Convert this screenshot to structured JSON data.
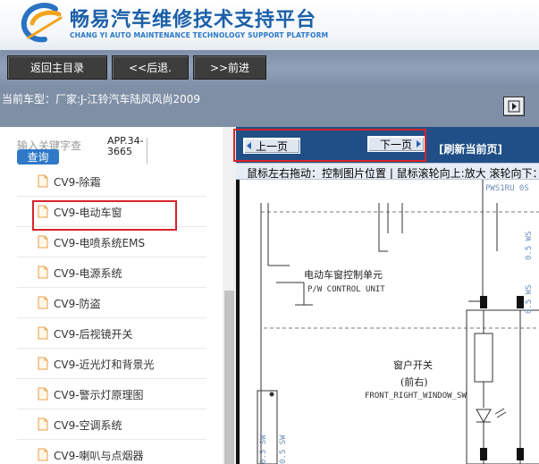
{
  "header": {
    "title": "畅易汽车维修技术支持平台",
    "subtitle": "CHANG YI AUTO MAINTENANCE TECHNOLOGY SUPPORT PLATFORM",
    "logo_icon": "swoosh-c-logo-icon"
  },
  "toolbar": {
    "home_label": "返回主目录",
    "back_label": "<<后退.",
    "forward_label": ">>前进"
  },
  "vehicle": {
    "label": "当前车型：",
    "value": "厂家:J-江铃汽车陆风风尚2009"
  },
  "search": {
    "hint": "输入关键字查",
    "button_label": "查询",
    "app_code": "APP.34-3665"
  },
  "tree": {
    "items": [
      {
        "label": "CV9-除霜",
        "selected": false
      },
      {
        "label": "CV9-电动车窗",
        "selected": true
      },
      {
        "label": "CV9-电喷系统EMS",
        "selected": false
      },
      {
        "label": "CV9-电源系统",
        "selected": false
      },
      {
        "label": "CV9-防盗",
        "selected": false
      },
      {
        "label": "CV9-后视镜开关",
        "selected": false
      },
      {
        "label": "CV9-近光灯和背景光",
        "selected": false
      },
      {
        "label": "CV9-警示灯原理图",
        "selected": false
      },
      {
        "label": "CV9-空调系统",
        "selected": false
      },
      {
        "label": "CV9-喇叭与点烟器",
        "selected": false
      }
    ]
  },
  "viewer": {
    "prev_label": "上一页",
    "next_label": "下一页",
    "refresh_label": "[刷新当前页]",
    "help_text": "鼠标左右拖动：控制图片位置 | 鼠标滚轮向上:放大   滚轮向下："
  },
  "diagram": {
    "unit_cn": "电动车窗控制单元",
    "unit_en": "P/W CONTROL UNIT",
    "switch_cn": "窗户开关",
    "switch_cn2": "(前右)",
    "switch_en": "FRONT_RIGHT_WINDOW_SW",
    "top_label": "PWS1RU 0S",
    "side_label_1": "0.5 WS",
    "side_label_2": "0.5 WS",
    "bottom_label_1": "0.5 SW",
    "bottom_label_2": "0.5 SW"
  },
  "colors": {
    "brand_blue": "#1b5fa8",
    "toolbar_bg": "#8fa0b8",
    "nav_dark": "#1f4f86",
    "highlight_red": "#d8232a",
    "folder_icon": "#e7a04a"
  }
}
